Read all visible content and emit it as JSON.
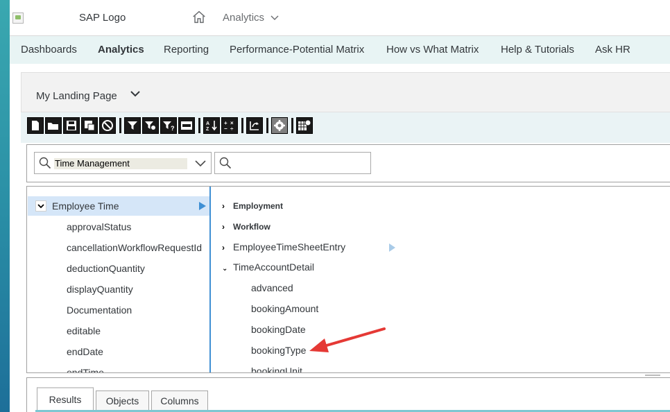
{
  "shell": {
    "logo_text": "SAP Logo",
    "app_title": "Analytics",
    "colors": {
      "accent": "#3e8fd4",
      "nav_bg": "#e8f4f4",
      "highlight": "#d5e6f8",
      "annotation": "#e53935"
    }
  },
  "navbar": {
    "items": [
      {
        "label": "Dashboards"
      },
      {
        "label": "Analytics"
      },
      {
        "label": "Reporting"
      },
      {
        "label": "Performance-Potential Matrix"
      },
      {
        "label": "How vs What Matrix"
      },
      {
        "label": "Help & Tutorials"
      },
      {
        "label": "Ask HR"
      }
    ],
    "active": "Analytics"
  },
  "landing": {
    "label": "My Landing Page"
  },
  "toolbar": {
    "icons": [
      "new-doc-icon",
      "open-folder-icon",
      "save-icon",
      "save-as-icon",
      "cancel-icon",
      "filter-icon",
      "filter-settings-icon",
      "filter-help-icon",
      "prompt-icon",
      "sort-icon",
      "calculation-icon",
      "refresh-icon",
      "settings-gear-icon",
      "chart-table-icon"
    ]
  },
  "search": {
    "domain_value": "Time Management",
    "query_value": ""
  },
  "tree_left": {
    "root": "Employee Time",
    "children": [
      "approvalStatus",
      "cancellationWorkflowRequestId",
      "deductionQuantity",
      "displayQuantity",
      "Documentation",
      "editable",
      "endDate",
      "endTime"
    ]
  },
  "tree_right": {
    "nodes": [
      {
        "label": "Employment"
      },
      {
        "label": "Workflow"
      },
      {
        "label": "EmployeeTimeSheetEntry"
      },
      {
        "label": "TimeAccountDetail"
      }
    ],
    "leaves": [
      "advanced",
      "bookingAmount",
      "bookingDate",
      "bookingType",
      "bookingUnit"
    ]
  },
  "bottom_tabs": [
    {
      "label": "Results"
    },
    {
      "label": "Objects"
    },
    {
      "label": "Columns"
    }
  ]
}
